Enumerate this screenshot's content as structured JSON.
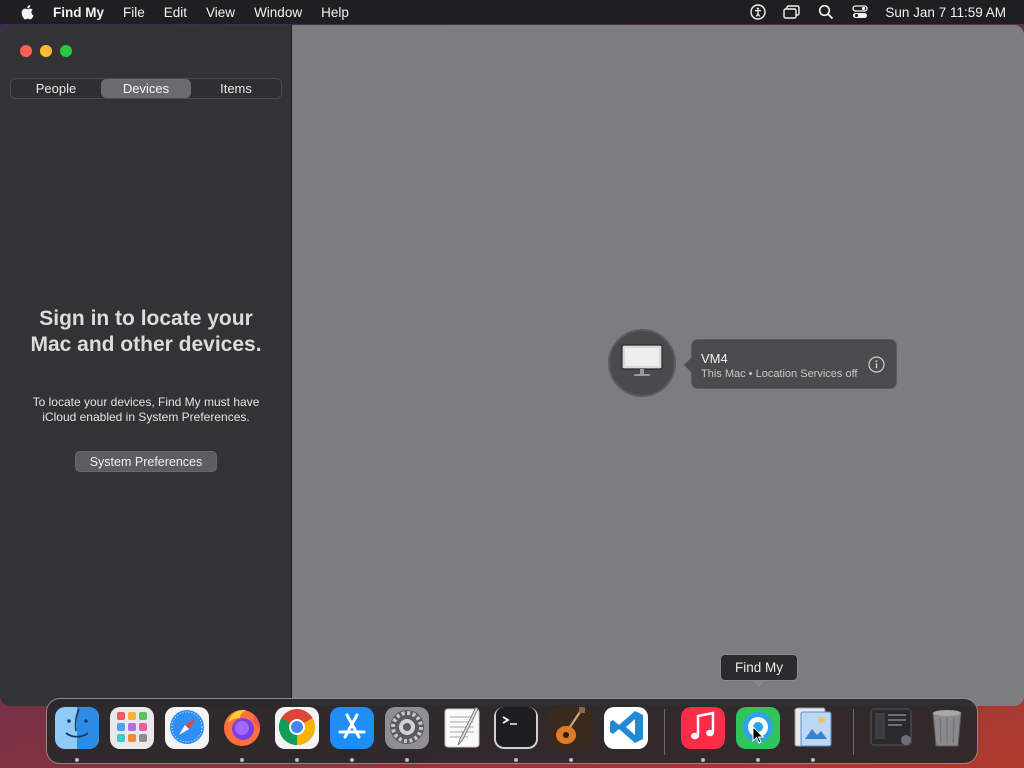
{
  "menubar": {
    "app_name": "Find My",
    "items": [
      "File",
      "Edit",
      "View",
      "Window",
      "Help"
    ],
    "clock": "Sun Jan 7  11:59 AM",
    "status_icons": [
      "accessibility-icon",
      "screen-mirroring-icon",
      "spotlight-search-icon",
      "control-center-icon"
    ]
  },
  "sidebar": {
    "tabs": [
      "People",
      "Devices",
      "Items"
    ],
    "selected_tab": "Devices",
    "signin_title": "Sign in to locate your Mac and other devices.",
    "signin_body": "To locate your devices, Find My must have iCloud enabled in System Preferences.",
    "button_label": "System Preferences"
  },
  "device": {
    "name": "VM4",
    "subtitle": "This Mac • Location Services off"
  },
  "tooltip": "Find My",
  "dock": {
    "apps": [
      "Finder",
      "Launchpad",
      "Safari",
      "Firefox",
      "Google Chrome",
      "App Store",
      "System Preferences",
      "TextEdit",
      "Terminal",
      "GarageBand",
      "Visual Studio Code",
      "Music",
      "Find My",
      "Preview",
      "Downloads",
      "Trash"
    ]
  },
  "colors": {
    "accent_red": "#ff5f57",
    "accent_yellow": "#febc2e",
    "accent_green": "#28c840",
    "sidebar_bg": "#333335",
    "map_bg": "#7d7d7f"
  }
}
